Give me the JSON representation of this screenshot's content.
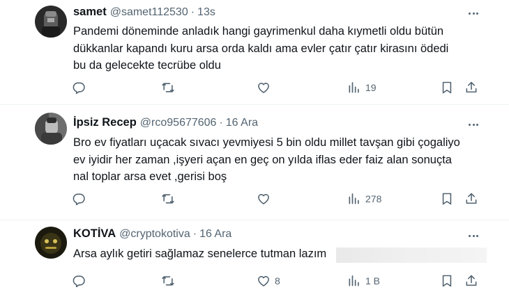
{
  "tweets": [
    {
      "name": "samet",
      "handle": "@samet112530",
      "time": "13s",
      "lines": [
        "Pandemi döneminde anladık hangi gayrimenkul daha kıymetli oldu bütün",
        "dükkanlar kapandı kuru arsa orda kaldı ama evler çatır çatır kirasını ödedi",
        "bu da gelecekte tecrübe oldu"
      ],
      "likes": "",
      "views": "19"
    },
    {
      "name": "İpsiz Recep",
      "handle": "@rco95677606",
      "time": "16 Ara",
      "lines": [
        "Bro ev fiyatları uçacak sıvacı yevmiyesi 5 bin oldu millet tavşan gibi çogaliyo",
        "ev iyidir her zaman ,işyeri açan en geç on yılda iflas eder faiz alan sonuçta",
        "nal toplar arsa evet ,gerisi boş"
      ],
      "likes": "",
      "views": "278"
    },
    {
      "name": "KOTİVA",
      "handle": "@cryptokotiva",
      "time": "16 Ara",
      "lines": [
        "Arsa aylık getiri sağlamaz senelerce tutman lazım"
      ],
      "likes": "8",
      "views": "1 B"
    }
  ],
  "icons": {
    "reply": "reply-icon",
    "repost": "repost-icon",
    "like": "heart-icon",
    "views": "views-icon",
    "bookmark": "bookmark-icon",
    "share": "share-icon",
    "more": "more-icon"
  },
  "colors": {
    "text": "#0f1419",
    "secondary": "#536471",
    "divider": "#eff3f4"
  }
}
